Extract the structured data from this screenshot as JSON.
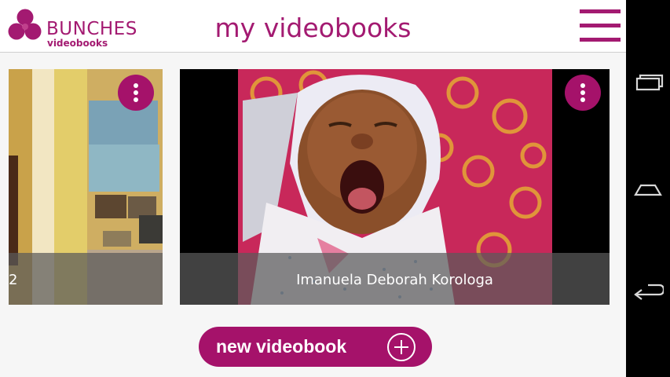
{
  "header": {
    "logo_name": "BUNCHES",
    "logo_sub": "videobooks",
    "title": "my videobooks",
    "menu_icon": "hamburger-menu-icon"
  },
  "videobooks": [
    {
      "caption": "2",
      "more_icon": "more-vertical-icon"
    },
    {
      "caption": "Imanuela Deborah Korologa",
      "more_icon": "more-vertical-icon"
    }
  ],
  "new_button": {
    "label": "new videobook",
    "icon": "plus-circle-icon"
  },
  "system_nav": {
    "items": [
      "recent-apps-icon",
      "home-icon",
      "back-icon"
    ]
  },
  "colors": {
    "brand": "#a31a71",
    "button": "#a5126a",
    "caption_overlay": "#5a5a5a"
  }
}
